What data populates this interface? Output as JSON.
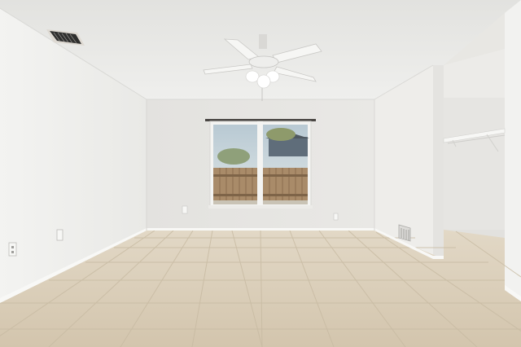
{
  "scene": {
    "type": "empty-room-photo",
    "colors": {
      "ceiling": "#ebebe8",
      "wall_left": "#f1f1ef",
      "wall_back": "#e7e6e3",
      "wall_right": "#eceae7",
      "floor": "#d9cdb8",
      "grout": "#c4b79f",
      "trim": "#f7f7f5",
      "sky": "#c9d8de",
      "fence": "#a98b69"
    },
    "elements": [
      "ceiling-fan-icon",
      "window",
      "ac-vent-icon",
      "floor-vent-icon",
      "outlet-icon",
      "closet-shelf"
    ]
  }
}
